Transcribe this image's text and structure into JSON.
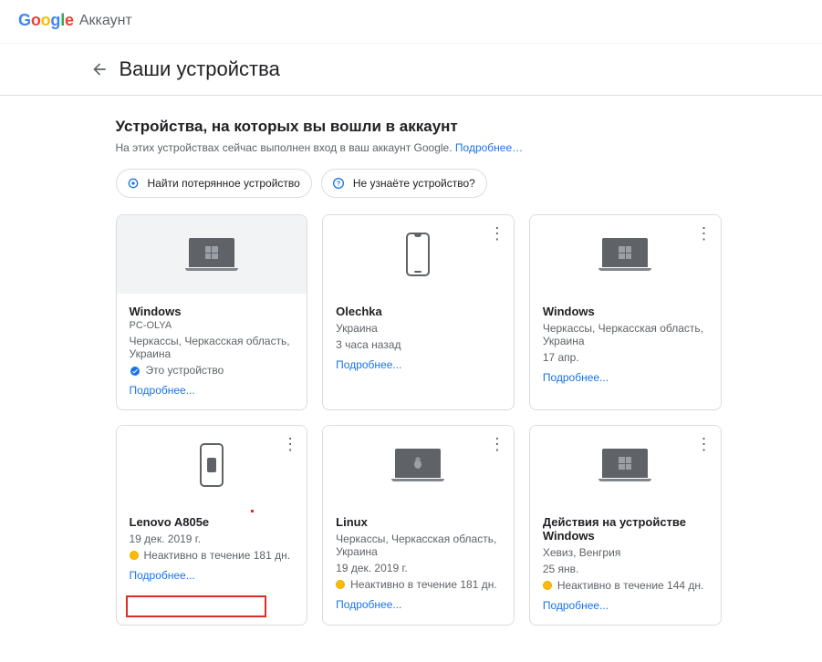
{
  "header": {
    "product": "Аккаунт"
  },
  "titlebar": {
    "title": "Ваши устройства"
  },
  "section": {
    "heading": "Устройства, на которых вы вошли в аккаунт",
    "sub": "На этих устройствах сейчас выполнен вход в ваш аккаунт Google. ",
    "sub_link": "Подробнее…"
  },
  "chips": {
    "find": "Найти потерянное устройство",
    "unknown": "Не узнаёте устройство?"
  },
  "more_link": "Подробнее...",
  "devices": [
    {
      "name": "Windows",
      "sub": "PC-OLYA",
      "loc": "Черкассы, Черкасская область, Украина",
      "status_kind": "this",
      "status": "Это устройство"
    },
    {
      "name": "Olechka",
      "loc": "Украина",
      "time": "3 часа назад"
    },
    {
      "name": "Windows",
      "loc": "Черкассы, Черкасская область, Украина",
      "time": "17 апр."
    },
    {
      "name": "Lenovo A805e",
      "time": "19 дек. 2019 г.",
      "status_kind": "inactive",
      "status": "Неактивно в течение 181 дн."
    },
    {
      "name": "Linux",
      "loc": "Черкассы, Черкасская область, Украина",
      "time": "19 дек. 2019 г.",
      "status_kind": "inactive",
      "status": "Неактивно в течение 181 дн."
    },
    {
      "name": "Действия на устройстве Windows",
      "loc": "Хевиз, Венгрия",
      "time": "25 янв.",
      "status_kind": "inactive",
      "status": "Неактивно в течение 144 дн."
    }
  ]
}
